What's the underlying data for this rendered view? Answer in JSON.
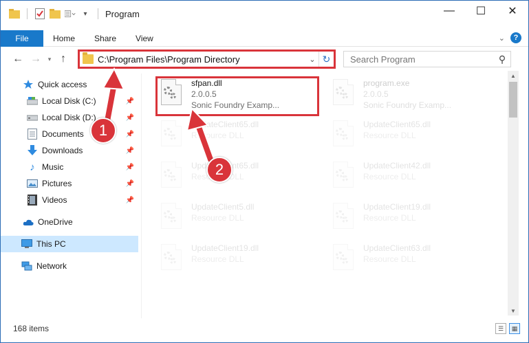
{
  "window": {
    "title": "Program",
    "controls": {
      "minimize": "—",
      "maximize": "☐",
      "close": "✕"
    }
  },
  "ribbon": {
    "tabs": [
      "File",
      "Home",
      "Share",
      "View"
    ],
    "help": "?"
  },
  "navigation": {
    "address_path": "C:\\Program Files\\Program Directory",
    "search_placeholder": "Search Program"
  },
  "sidebar": {
    "items": [
      {
        "label": "Quick access",
        "icon": "star-icon"
      },
      {
        "label": "Local Disk (C:)",
        "icon": "drive-icon",
        "pinned": true
      },
      {
        "label": "Local Disk (D:)",
        "icon": "drive-icon",
        "pinned": true
      },
      {
        "label": "Documents",
        "icon": "documents-icon",
        "pinned": true
      },
      {
        "label": "Downloads",
        "icon": "download-icon",
        "pinned": true
      },
      {
        "label": "Music",
        "icon": "music-icon",
        "pinned": true
      },
      {
        "label": "Pictures",
        "icon": "pictures-icon",
        "pinned": true
      },
      {
        "label": "Videos",
        "icon": "videos-icon",
        "pinned": true
      },
      {
        "label": "OneDrive",
        "icon": "cloud-icon"
      },
      {
        "label": "This PC",
        "icon": "computer-icon",
        "selected": true
      },
      {
        "label": "Network",
        "icon": "network-icon"
      }
    ]
  },
  "files": [
    {
      "name": "sfpan.dll",
      "line2": "2.0.0.5",
      "line3": "Sonic Foundry Examp...",
      "highlighted": true
    },
    {
      "name": "program.exe",
      "line2": "2.0.0.5",
      "line3": "Sonic Foundry Examp..."
    },
    {
      "name": "UpdateClient65.dll",
      "line2": "Resource DLL"
    },
    {
      "name": "UpdateClient65.dll",
      "line2": "Resource DLL"
    },
    {
      "name": "UpdateClient65.dll",
      "line2": "Resource DLL"
    },
    {
      "name": "UpdateClient42.dll",
      "line2": "Resource DLL"
    },
    {
      "name": "UpdateClient5.dll",
      "line2": "Resource DLL"
    },
    {
      "name": "UpdateClient19.dll",
      "line2": "Resource DLL"
    },
    {
      "name": "UpdateClient19.dll",
      "line2": "Resource DLL"
    },
    {
      "name": "UpdateClient63.dll",
      "line2": "Resource DLL"
    }
  ],
  "status": {
    "item_count": "168 items"
  },
  "annotations": {
    "step1": "1",
    "step2": "2"
  },
  "colors": {
    "accent": "#1979ca",
    "highlight_red": "#d9343a",
    "selection": "#cde8ff"
  }
}
